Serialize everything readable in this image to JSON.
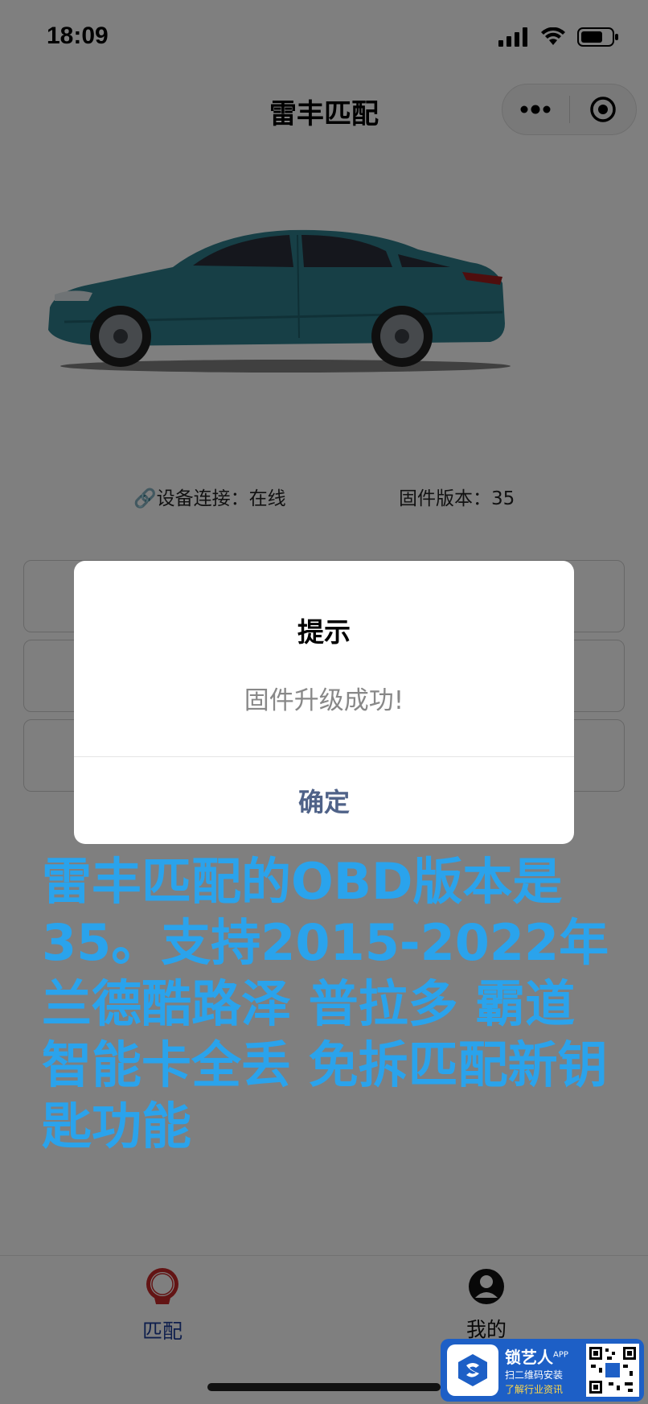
{
  "status_bar": {
    "time": "18:09"
  },
  "nav": {
    "title": "雷丰匹配"
  },
  "info": {
    "connection": "🔗设备连接：在线",
    "firmware": "固件版本：35"
  },
  "modal": {
    "title": "提示",
    "content": "固件升级成功!",
    "confirm": "确定"
  },
  "overlay_note": "雷丰匹配的OBD版本是35。支持2015-2022年兰德酷路泽 普拉多 霸道 智能卡全丢 免拆匹配新钥匙功能",
  "tabbar": {
    "items": [
      {
        "label": "匹配",
        "icon": "start-stop-icon",
        "active": true
      },
      {
        "label": "我的",
        "icon": "user-icon",
        "active": false
      }
    ]
  },
  "watermark": {
    "brand": "锁艺人",
    "brand_sup": "APP",
    "line1": "扫二维码安装",
    "line2": "了解行业资讯"
  },
  "colors": {
    "overlay_text": "#2aa3ec",
    "confirm": "#4f6288",
    "tab_active": "#1f3f9a",
    "car_body": "#2e7f8d"
  }
}
